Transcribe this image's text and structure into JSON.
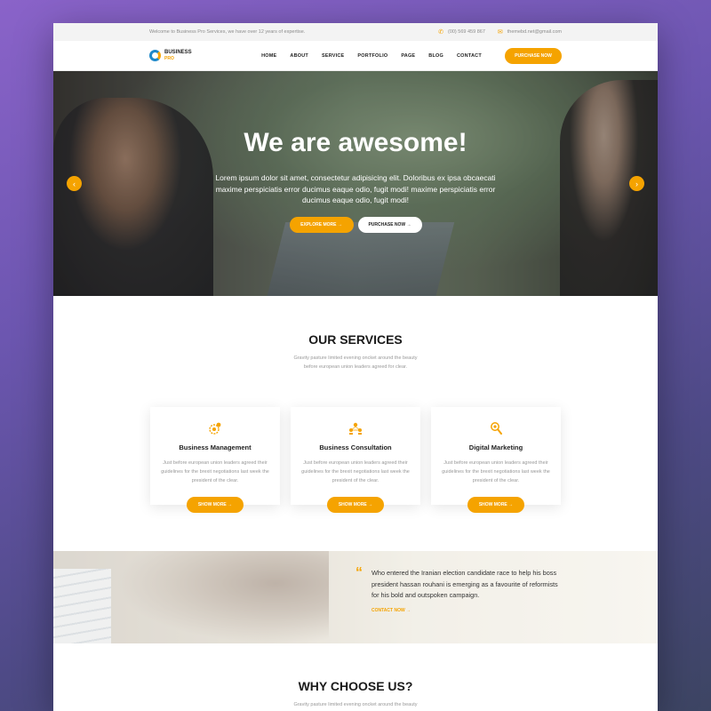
{
  "topbar": {
    "welcome": "Welcome to Business Pro Services, we have over 12 years of expertise.",
    "phone": "(00) 569 459 867",
    "email": "themebd.net@gmail.com"
  },
  "logo": {
    "line1": "BUSINESS",
    "line2": "PRO"
  },
  "nav": {
    "items": [
      "HOME",
      "ABOUT",
      "SERVICE",
      "PORTFOLIO",
      "PAGE",
      "BLOG",
      "CONTACT"
    ],
    "cta": "PURCHASE NOW"
  },
  "hero": {
    "title": "We are awesome!",
    "text": "Lorem ipsum dolor sit amet, consectetur adipisicing elit. Doloribus ex ipsa obcaecati maxime perspiciatis error ducimus eaque odio, fugit modi! maxime perspiciatis error ducimus eaque odio, fugit modi!",
    "explore": "EXPLORE MORE  →",
    "purchase": "PURCHASE NOW  →",
    "prev": "‹",
    "next": "›"
  },
  "services": {
    "title": "OUR SERVICES",
    "subtitle_line1": "Gravity pasture limited evening oncket around the beauty",
    "subtitle_line2": "before european union leaders agreed for clear.",
    "cards": [
      {
        "title": "Business Management",
        "text": "Just before european union leaders agreed their guidelines for the brexit negotiations last week the president of the clear.",
        "button": "SHOW MORE  →",
        "icon": "gear-chart-icon"
      },
      {
        "title": "Business Consultation",
        "text": "Just before european union leaders agreed their guidelines for the brexit negotiations last week the president of the clear.",
        "button": "SHOW MORE  →",
        "icon": "team-icon"
      },
      {
        "title": "Digital Marketing",
        "text": "Just before european union leaders agreed their guidelines for the brexit negotiations last week the president of the clear.",
        "button": "SHOW MORE  →",
        "icon": "magnifier-icon"
      }
    ]
  },
  "quote": {
    "mark": "“",
    "text": "Who entered the Iranian election candidate race to help his boss president hassan rouhani is emerging as a favourite of reformists for his bold and outspoken campaign.",
    "link": "CONTACT NOW  →"
  },
  "why": {
    "title": "WHY CHOOSE US?",
    "subtitle_line1": "Gravity pasture limited evening oncket around the beauty"
  },
  "colors": {
    "accent": "#f5a300",
    "logo_blue": "#1e88c9"
  }
}
